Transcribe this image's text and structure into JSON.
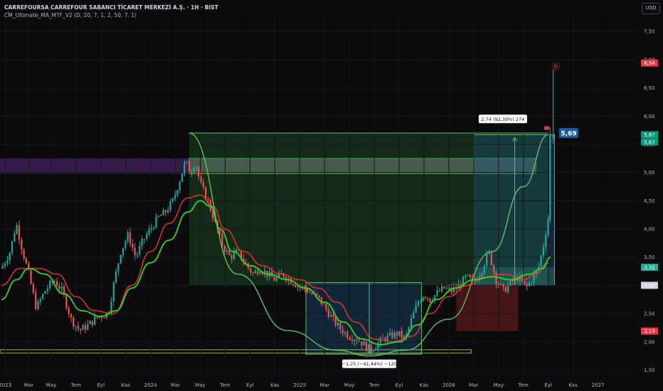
{
  "header": {
    "title": "CARREFOURSA CARREFOUR SABANCI TİCARET MERKEZİ A.Ş. · 1H · BIST",
    "indicator": "CM_Ultimate_MA_MTF_V2 (D, 20, 7, 1, 2, 50, 7, 1)"
  },
  "currency": "USD",
  "chart_data": {
    "type": "candlestick",
    "y_ticks": [
      1.5,
      2.0,
      2.5,
      3.0,
      3.5,
      4.0,
      4.5,
      5.0,
      5.5,
      6.0,
      6.5,
      7.0,
      7.5
    ],
    "ylim": [
      1.33,
      7.78
    ],
    "x_labels": [
      {
        "label": "2023",
        "t": 0.3
      },
      {
        "label": "Mar",
        "t": 2.2
      },
      {
        "label": "May",
        "t": 4.0
      },
      {
        "label": "Tem",
        "t": 6.0
      },
      {
        "label": "Eyl",
        "t": 8.0
      },
      {
        "label": "Kas",
        "t": 10.0
      },
      {
        "label": "2024",
        "t": 12.0
      },
      {
        "label": "Mar",
        "t": 14.0
      },
      {
        "label": "May",
        "t": 16.0
      },
      {
        "label": "Tem",
        "t": 18.0
      },
      {
        "label": "Eyl",
        "t": 20.0
      },
      {
        "label": "Kas",
        "t": 22.0
      },
      {
        "label": "2025",
        "t": 24.0
      },
      {
        "label": "Mar",
        "t": 26.0
      },
      {
        "label": "May",
        "t": 28.0
      },
      {
        "label": "Tem",
        "t": 30.0
      },
      {
        "label": "Eyl",
        "t": 32.0
      },
      {
        "label": "Kas",
        "t": 34.0
      },
      {
        "label": "2026",
        "t": 36.0
      },
      {
        "label": "Mar",
        "t": 38.0
      },
      {
        "label": "May",
        "t": 40.0
      },
      {
        "label": "Tem",
        "t": 42.0
      },
      {
        "label": "Eyl",
        "t": 44.0
      },
      {
        "label": "Kas",
        "t": 46.0
      },
      {
        "label": "2027",
        "t": 48.0
      }
    ],
    "xlim": [
      0,
      51
    ],
    "price_path": [
      [
        0,
        3.3
      ],
      [
        0.7,
        3.6
      ],
      [
        1.2,
        4.1
      ],
      [
        1.6,
        3.7
      ],
      [
        2.2,
        3.2
      ],
      [
        2.8,
        2.6
      ],
      [
        3.5,
        2.9
      ],
      [
        4.2,
        3.1
      ],
      [
        4.9,
        2.9
      ],
      [
        5.6,
        2.4
      ],
      [
        6.3,
        2.2
      ],
      [
        7.0,
        2.3
      ],
      [
        7.8,
        2.45
      ],
      [
        8.6,
        2.5
      ],
      [
        9.1,
        3.1
      ],
      [
        9.6,
        3.6
      ],
      [
        10.2,
        3.9
      ],
      [
        10.8,
        3.5
      ],
      [
        11.4,
        3.8
      ],
      [
        12.0,
        4.0
      ],
      [
        12.6,
        4.2
      ],
      [
        13.2,
        4.3
      ],
      [
        13.8,
        4.5
      ],
      [
        14.4,
        4.9
      ],
      [
        14.8,
        5.2
      ],
      [
        15.2,
        5.0
      ],
      [
        15.6,
        5.2
      ],
      [
        16.0,
        4.8
      ],
      [
        16.6,
        4.5
      ],
      [
        17.2,
        4.1
      ],
      [
        17.8,
        3.7
      ],
      [
        18.4,
        3.5
      ],
      [
        19.0,
        3.6
      ],
      [
        19.6,
        3.4
      ],
      [
        20.2,
        3.2
      ],
      [
        20.8,
        3.3
      ],
      [
        21.4,
        3.2
      ],
      [
        22.0,
        3.1
      ],
      [
        22.6,
        3.2
      ],
      [
        23.2,
        3.1
      ],
      [
        23.8,
        3.0
      ],
      [
        24.4,
        2.95
      ],
      [
        25.0,
        2.85
      ],
      [
        25.6,
        2.75
      ],
      [
        26.2,
        2.55
      ],
      [
        26.8,
        2.35
      ],
      [
        27.4,
        2.2
      ],
      [
        28.0,
        2.1
      ],
      [
        28.6,
        2.05
      ],
      [
        29.2,
        1.95
      ],
      [
        29.7,
        1.85
      ],
      [
        30.2,
        1.95
      ],
      [
        30.7,
        2.05
      ],
      [
        31.3,
        2.1
      ],
      [
        31.9,
        2.15
      ],
      [
        32.5,
        2.05
      ],
      [
        33.0,
        2.4
      ],
      [
        33.5,
        2.7
      ],
      [
        34.0,
        2.85
      ],
      [
        34.5,
        2.75
      ],
      [
        35.0,
        2.85
      ],
      [
        35.6,
        2.95
      ],
      [
        36.2,
        2.9
      ],
      [
        36.8,
        3.0
      ],
      [
        37.4,
        3.15
      ],
      [
        38.0,
        3.05
      ],
      [
        38.6,
        3.25
      ],
      [
        39.2,
        3.6
      ],
      [
        39.8,
        3.1
      ],
      [
        40.4,
        2.9
      ],
      [
        41.0,
        3.05
      ],
      [
        41.6,
        3.15
      ],
      [
        42.2,
        2.95
      ],
      [
        42.8,
        3.15
      ],
      [
        43.2,
        3.3
      ],
      [
        43.6,
        3.7
      ],
      [
        44.0,
        4.2
      ],
      [
        44.2,
        5.67
      ]
    ],
    "ma_red": [
      [
        0,
        3.0
      ],
      [
        1.5,
        3.3
      ],
      [
        3.0,
        3.3
      ],
      [
        4.5,
        3.2
      ],
      [
        6.0,
        2.8
      ],
      [
        7.5,
        2.55
      ],
      [
        9.0,
        2.5
      ],
      [
        10.5,
        3.0
      ],
      [
        12.0,
        3.6
      ],
      [
        13.5,
        4.1
      ],
      [
        15.0,
        4.55
      ],
      [
        16.0,
        4.6
      ],
      [
        17.0,
        4.4
      ],
      [
        18.0,
        4.0
      ],
      [
        19.5,
        3.6
      ],
      [
        21.0,
        3.35
      ],
      [
        22.5,
        3.2
      ],
      [
        24.0,
        3.1
      ],
      [
        25.5,
        2.95
      ],
      [
        27.0,
        2.7
      ],
      [
        28.5,
        2.35
      ],
      [
        30.0,
        2.05
      ],
      [
        31.5,
        2.0
      ],
      [
        33.0,
        2.1
      ],
      [
        34.5,
        2.5
      ],
      [
        36.0,
        2.8
      ],
      [
        37.5,
        3.0
      ],
      [
        39.0,
        3.15
      ],
      [
        40.5,
        3.2
      ],
      [
        42.0,
        3.1
      ],
      [
        43.0,
        3.2
      ],
      [
        44.0,
        3.4
      ]
    ],
    "ma_green": [
      [
        0,
        2.75
      ],
      [
        1.2,
        3.1
      ],
      [
        2.2,
        3.3
      ],
      [
        3.5,
        3.2
      ],
      [
        5.0,
        2.85
      ],
      [
        6.5,
        2.55
      ],
      [
        8.0,
        2.45
      ],
      [
        9.2,
        2.55
      ],
      [
        10.5,
        2.95
      ],
      [
        12.0,
        3.4
      ],
      [
        13.5,
        3.8
      ],
      [
        15.0,
        4.3
      ],
      [
        16.0,
        4.5
      ],
      [
        16.8,
        4.4
      ],
      [
        17.6,
        4.0
      ],
      [
        18.6,
        3.6
      ],
      [
        20.0,
        3.35
      ],
      [
        21.5,
        3.2
      ],
      [
        23.0,
        3.1
      ],
      [
        24.5,
        2.95
      ],
      [
        26.0,
        2.7
      ],
      [
        27.5,
        2.35
      ],
      [
        29.0,
        2.05
      ],
      [
        30.5,
        1.95
      ],
      [
        32.0,
        2.0
      ],
      [
        33.5,
        2.3
      ],
      [
        35.0,
        2.75
      ],
      [
        36.5,
        2.95
      ],
      [
        38.0,
        3.1
      ],
      [
        39.5,
        3.15
      ],
      [
        41.0,
        3.1
      ],
      [
        42.5,
        3.2
      ],
      [
        43.5,
        3.3
      ],
      [
        44.2,
        3.5
      ]
    ],
    "cup_curve": [
      [
        15.1,
        5.7
      ],
      [
        19.0,
        3.2
      ],
      [
        23.0,
        2.2
      ],
      [
        27.0,
        1.85
      ],
      [
        29.6,
        1.75
      ],
      [
        32.5,
        1.85
      ],
      [
        36.0,
        2.4
      ],
      [
        39.5,
        3.6
      ],
      [
        42.0,
        4.75
      ],
      [
        44.0,
        5.67
      ]
    ],
    "annotations": {
      "drop_label": "−1,25 (−41,44%) −125",
      "rise_label": "2,74 (92,39%) 274",
      "signal_letter": "D"
    },
    "price_tags": [
      {
        "label": "6,94",
        "value": 6.94,
        "color": "#f23645"
      },
      {
        "label": "5,69",
        "value": 5.7,
        "color": "#2962ff"
      },
      {
        "label": "5,67",
        "value": 5.67,
        "color": "#089981"
      },
      {
        "label": "5,67",
        "value": 5.54,
        "color": "#089981"
      },
      {
        "label": "3,32",
        "value": 3.32,
        "color": "#22ab94"
      },
      {
        "label": "3,00",
        "value": 3.0,
        "color": "#b2b5be"
      },
      {
        "label": "2,19",
        "value": 2.19,
        "color": "#f23645"
      }
    ]
  }
}
